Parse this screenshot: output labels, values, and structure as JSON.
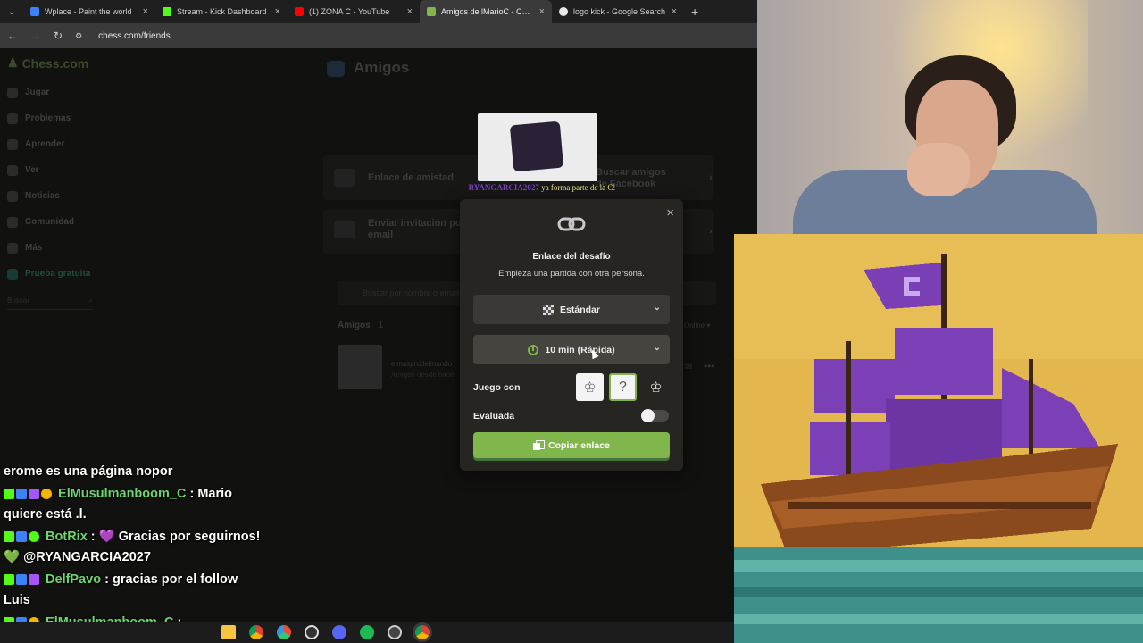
{
  "browser": {
    "tabs": [
      {
        "label": "Wplace - Paint the world",
        "favicon_color": "#3b82f6",
        "active": false
      },
      {
        "label": "Stream - Kick Dashboard",
        "favicon_color": "#53fc18",
        "active": false
      },
      {
        "label": "(1) ZONA C - YouTube",
        "favicon_color": "#ff0000",
        "active": false
      },
      {
        "label": "Amigos de lMarioC - Chess.com",
        "favicon_color": "#81b64c",
        "active": true
      },
      {
        "label": "logo kick - Google Search",
        "favicon_color": "#e8e8e8",
        "active": false
      }
    ],
    "url": "chess.com/friends"
  },
  "sidebar": {
    "logo": "Chess.com",
    "items": [
      "Jugar",
      "Problemas",
      "Aprender",
      "Ver",
      "Noticias",
      "Comunidad",
      "Más",
      "Prueba gratuita"
    ],
    "search_placeholder": "Buscar"
  },
  "main": {
    "title": "Amigos",
    "friendship_link": "Enlace de amistad",
    "facebook_friends": "Buscar amigos de Facebook",
    "email_invite": "Enviar invitación por email",
    "search_placeholder": "Buscar por nombre o email",
    "friends_heading": "Amigos",
    "friends_count": "1",
    "online_filter": "Online",
    "friend_name": "elmasprodelmundo",
    "friend_sub": "Amigos desde hace"
  },
  "stream_alert": {
    "username": "RYANGARCIA2027",
    "message": "ya forma parte de la C!"
  },
  "modal": {
    "title": "Enlace del desafío",
    "subtitle": "Empieza una partida con otra persona.",
    "variant_select": "Estándar",
    "time_select": "10 min (Rápida)",
    "play_as_label": "Juego con",
    "rated_label": "Evaluada",
    "rated": false,
    "copy_button": "Copiar enlace",
    "accent": "#81b64c"
  },
  "chat": {
    "partial_line": "erome es una página nopor",
    "messages": [
      {
        "user": "ElMusulmanboom_C",
        "text": "Mario quiere está .l."
      },
      {
        "user": "BotRix",
        "text": "💜 Gracias por seguirnos! 💚 @RYANGARCIA2027"
      },
      {
        "user": "DelfPavo",
        "text": "gracias por el follow Luis"
      },
      {
        "user": "ElMusulmanboom_C",
        "text": ""
      }
    ]
  }
}
